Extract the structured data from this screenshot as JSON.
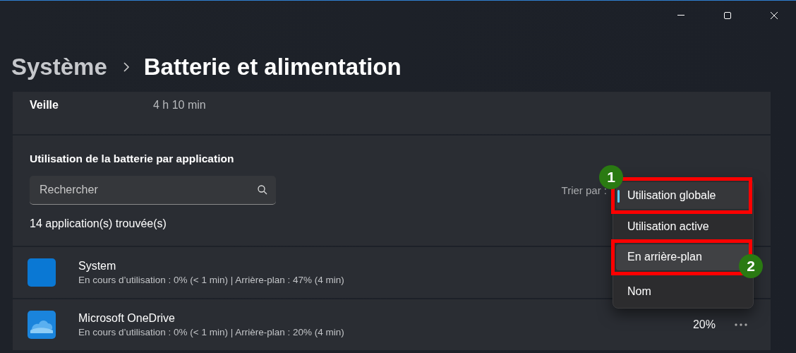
{
  "breadcrumb": {
    "parent": "Système",
    "current": "Batterie et alimentation"
  },
  "summary_row": {
    "label": "Veille",
    "value": "4 h 10 min"
  },
  "usage": {
    "heading": "Utilisation de la batterie par application",
    "search": {
      "placeholder": "Rechercher"
    },
    "count": "14 application(s) trouvée(s)",
    "sort_label": "Trier par :"
  },
  "apps": [
    {
      "name": "System",
      "detail": "En cours d’utilisation : 0% (< 1 min) | Arrière-plan : 47% (4 min)",
      "kind": "plain",
      "color": "#0a78d4"
    },
    {
      "name": "Microsoft OneDrive",
      "detail": "En cours d’utilisation : 0% (< 1 min) | Arrière-plan : 20% (4 min)",
      "kind": "cloud",
      "color": "#1a84dc",
      "percent": "20%"
    }
  ],
  "sort_menu": [
    {
      "label": "Utilisation globale",
      "selected": true,
      "hovered": false,
      "callout": "1"
    },
    {
      "label": "Utilisation active",
      "selected": false,
      "hovered": false
    },
    {
      "label": "En arrière-plan",
      "selected": false,
      "hovered": true,
      "callout": "2"
    },
    {
      "label": "Nom",
      "selected": false,
      "hovered": false
    }
  ]
}
